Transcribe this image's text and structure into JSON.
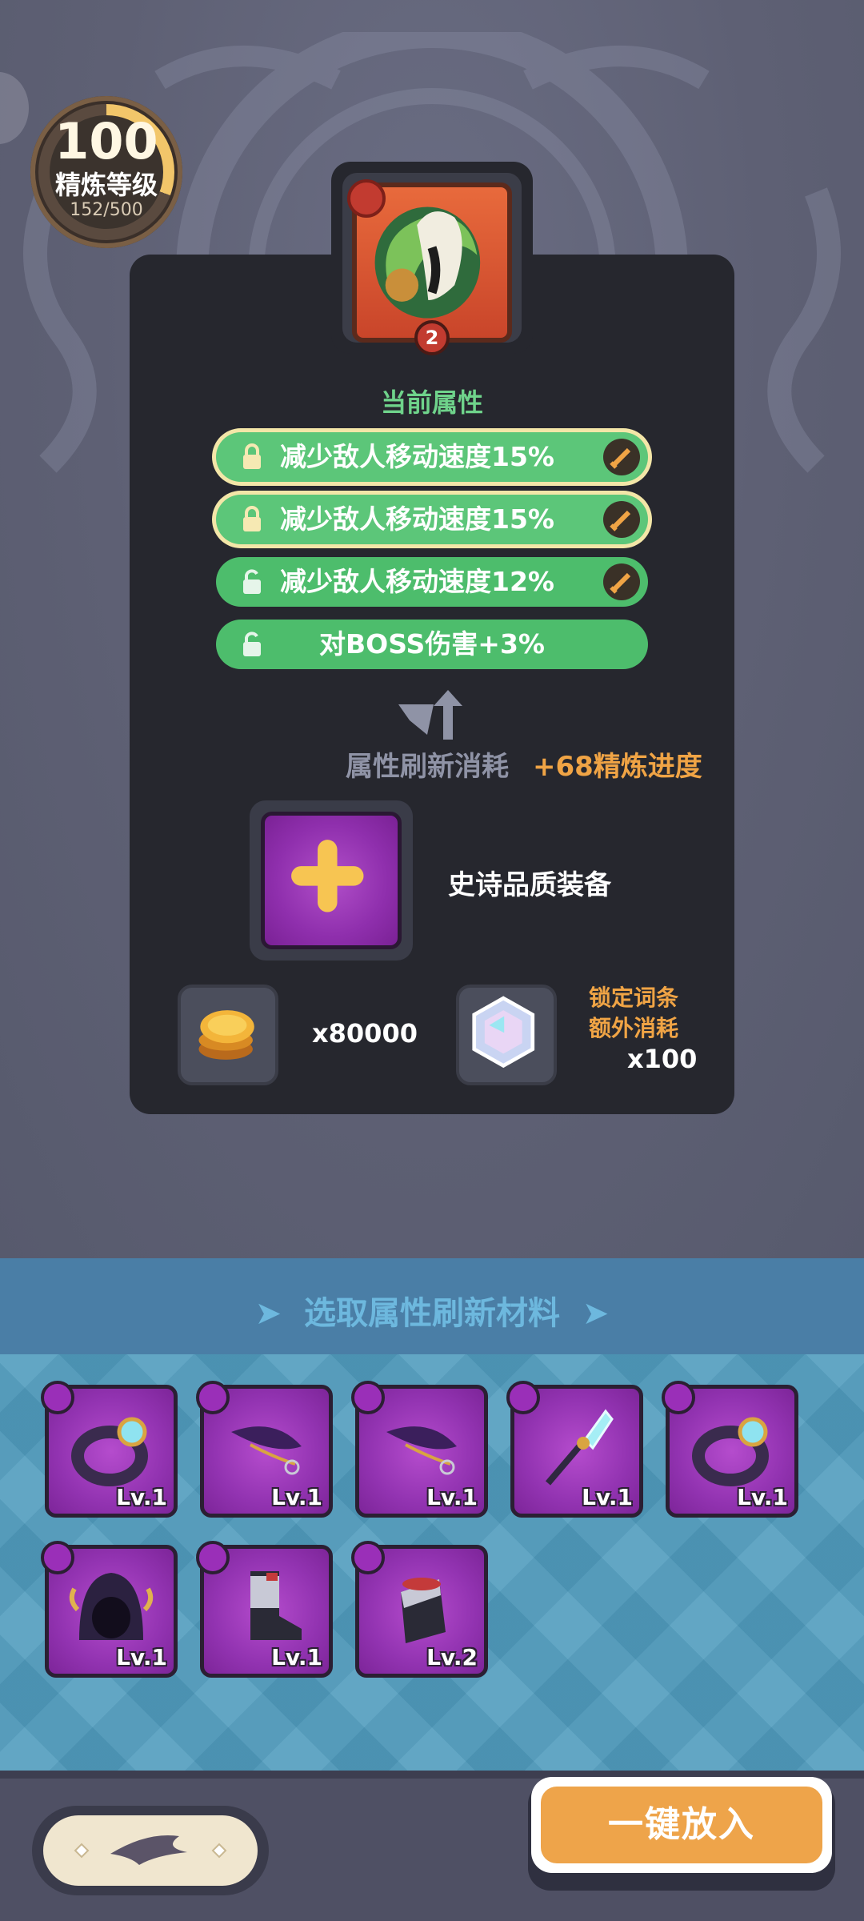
{
  "refine": {
    "level": "100",
    "title": "精炼等级",
    "progress": "152/500"
  },
  "item": {
    "quantity": "2"
  },
  "attributes": {
    "section_title": "当前属性",
    "items": [
      {
        "text": "减少敌人移动速度15%",
        "locked": true
      },
      {
        "text": "减少敌人移动速度15%",
        "locked": true
      },
      {
        "text": "减少敌人移动速度12%",
        "locked": false
      },
      {
        "text": "对BOSS伤害+3%",
        "locked": false
      }
    ]
  },
  "refresh": {
    "cost_label": "属性刷新消耗",
    "cost_value": "+68精炼进度"
  },
  "slot": {
    "label": "史诗品质装备"
  },
  "resources": {
    "gold": "x80000",
    "lock_note_line1": "锁定词条",
    "lock_note_line2": "额外消耗",
    "gem": "x100"
  },
  "materials": {
    "title": "选取属性刷新材料",
    "items": [
      {
        "name": "ring",
        "level": "Lv.1"
      },
      {
        "name": "feather-blade",
        "level": "Lv.1"
      },
      {
        "name": "feather-blade",
        "level": "Lv.1"
      },
      {
        "name": "crystal-staff",
        "level": "Lv.1"
      },
      {
        "name": "ring",
        "level": "Lv.1"
      },
      {
        "name": "hood",
        "level": "Lv.1"
      },
      {
        "name": "boots",
        "level": "Lv.1"
      },
      {
        "name": "bracer",
        "level": "Lv.2"
      }
    ]
  },
  "footer": {
    "auto_button": "一键放入"
  },
  "colors": {
    "attr_green": "#4dbd6c",
    "accent_orange": "#eea44a",
    "epic_purple": "#9233b1"
  }
}
